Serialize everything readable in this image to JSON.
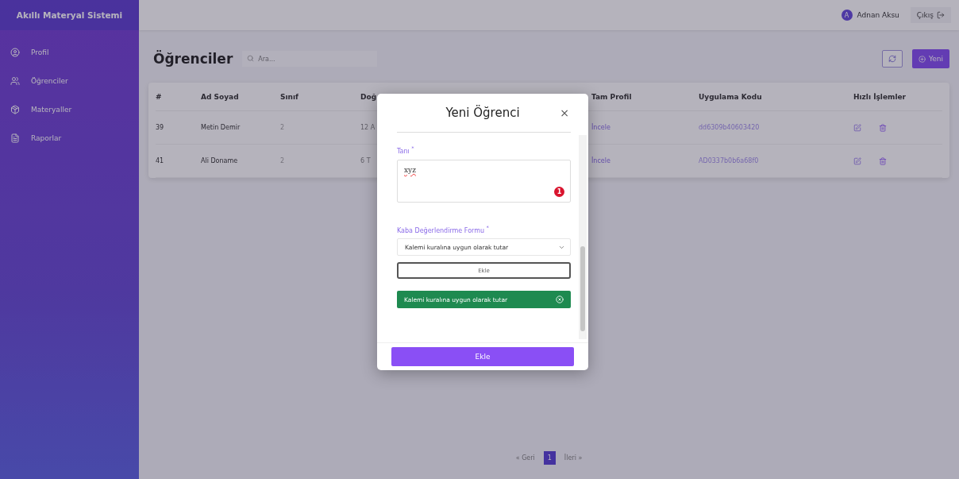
{
  "sidebar": {
    "title": "Akıllı Materyal Sistemi",
    "items": [
      {
        "label": "Profil",
        "kind": "profile",
        "selected": false
      },
      {
        "label": "Öğrenciler",
        "kind": "students",
        "selected": false
      },
      {
        "label": "Materyaller",
        "kind": "materials",
        "selected": false
      },
      {
        "label": "Raporlar",
        "kind": "reports",
        "selected": false
      }
    ]
  },
  "topbar": {
    "user": "Adnan Aksu",
    "avatar_initial": "A",
    "logout": "Çıkış"
  },
  "page": {
    "title": "Öğrenciler",
    "search": {
      "placeholder": "Ara..."
    },
    "new_button": "Yeni"
  },
  "table": {
    "columns": [
      "#",
      "Ad Soyad",
      "Sınıf",
      "Doğ",
      "Tam Profil",
      "Uygulama Kodu",
      "Hızlı İşlemler"
    ],
    "rows": [
      {
        "id": "39",
        "name": "Metin Demir",
        "class": "2",
        "column_4": "12 A",
        "profile_link": "İncele",
        "code": "dd6309b40603420"
      },
      {
        "id": "41",
        "name": "Ali Doname",
        "class": "2",
        "column_4": "6 T",
        "profile_link": "İncele",
        "code": "AD0337b0b6a68f0"
      }
    ]
  },
  "pagination": [
    {
      "label": "« Geri",
      "selected": false
    },
    {
      "label": "1",
      "selected": true
    },
    {
      "label": "İleri »",
      "selected": false
    }
  ],
  "modal": {
    "title": "Yeni Öğrenci",
    "close": "×",
    "diagnosis": {
      "label": "Tanı $^{*}$",
      "value": "xyz",
      "badge": "1"
    },
    "form": {
      "label": "Kaba Değerlendirme Formu $^{*}$",
      "select_value": "Kalemi kuralına uygun olarak tutar",
      "add_button": "Ekle"
    },
    "chips": [
      "Kalemi kuralına uygun olarak tutar"
    ],
    "submit": "Ekle"
  }
}
